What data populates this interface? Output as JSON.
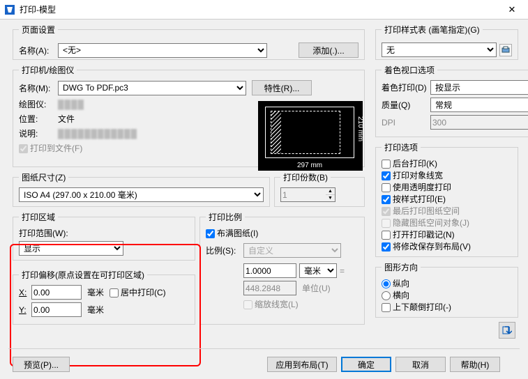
{
  "window": {
    "title": "打印-模型"
  },
  "page_setup": {
    "legend": "页面设置",
    "name_label": "名称(A):",
    "name_value": "<无>",
    "add_btn": "添加(.)..."
  },
  "printer": {
    "legend": "打印机/绘图仪",
    "name_label": "名称(M):",
    "name_value": "DWG To PDF.pc3",
    "props_btn": "特性(R)...",
    "plotter_label": "绘图仪:",
    "where_label": "位置:",
    "where_value": "文件",
    "desc_label": "说明:",
    "print_to_file_label": "打印到文件(F)",
    "preview_w": "297 mm",
    "preview_h": "210 mm"
  },
  "paper_size": {
    "legend": "图纸尺寸(Z)",
    "value": "ISO A4 (297.00 x 210.00 毫米)"
  },
  "copies": {
    "legend": "打印份数(B)",
    "value": "1"
  },
  "area": {
    "legend": "打印区域",
    "range_label": "打印范围(W):",
    "range_value": "显示"
  },
  "offset": {
    "legend": "打印偏移(原点设置在可打印区域)",
    "x_label": "X:",
    "y_label": "Y:",
    "x_value": "0.00",
    "y_value": "0.00",
    "unit": "毫米",
    "center_label": "居中打印(C)"
  },
  "scale": {
    "legend": "打印比例",
    "fit_label": "布满图纸(I)",
    "ratio_label": "比例(S):",
    "ratio_value": "自定义",
    "num": "1.0000",
    "unit": "毫米",
    "den": "448.2848",
    "den_unit": "单位(U)",
    "scale_lw_label": "缩放线宽(L)"
  },
  "style_table": {
    "legend": "打印样式表 (画笔指定)(G)",
    "value": "无"
  },
  "shaded": {
    "legend": "着色视口选项",
    "shade_label": "着色打印(D)",
    "shade_value": "按显示",
    "quality_label": "质量(Q)",
    "quality_value": "常规",
    "dpi_label": "DPI",
    "dpi_value": "300"
  },
  "options": {
    "legend": "打印选项",
    "bg": "后台打印(K)",
    "lw": "打印对象线宽",
    "trans": "使用透明度打印",
    "by_style": "按样式打印(E)",
    "last": "最后打印图纸空间",
    "hide": "隐藏图纸空间对象(J)",
    "stamp": "打开打印戳记(N)",
    "save": "将修改保存到布局(V)"
  },
  "orient": {
    "legend": "图形方向",
    "portrait": "纵向",
    "landscape": "横向",
    "upside": "上下颠倒打印(-)"
  },
  "footer": {
    "preview_btn": "预览(P)...",
    "apply_btn": "应用到布局(T)",
    "ok_btn": "确定",
    "cancel_btn": "取消",
    "help_btn": "帮助(H)"
  }
}
